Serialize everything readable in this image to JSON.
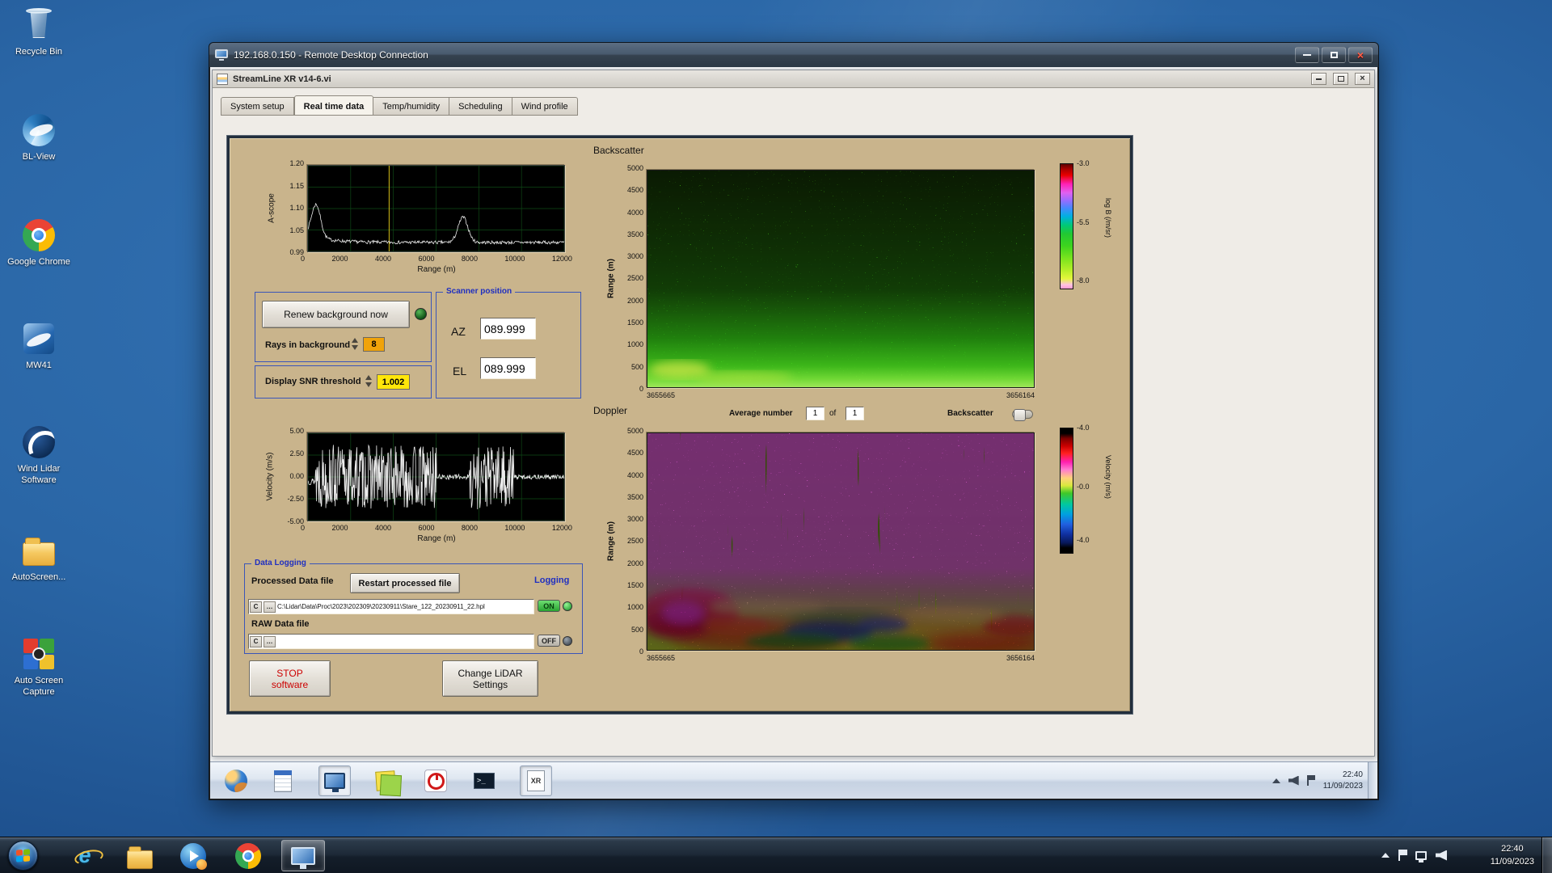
{
  "desktop": {
    "icons": [
      {
        "label": "Recycle Bin"
      },
      {
        "label": "BL-View"
      },
      {
        "label": "Google Chrome"
      },
      {
        "label": "MW41"
      },
      {
        "label": "Wind Lidar Software"
      },
      {
        "label": "AutoScreen..."
      },
      {
        "label": "Auto Screen Capture"
      }
    ]
  },
  "rdp": {
    "title": "192.168.0.150 - Remote Desktop Connection"
  },
  "app": {
    "title": "StreamLine XR v14-6.vi",
    "tabs": [
      {
        "label": "System setup",
        "active": false
      },
      {
        "label": "Real time data",
        "active": true
      },
      {
        "label": "Temp/humidity",
        "active": false
      },
      {
        "label": "Scheduling",
        "active": false
      },
      {
        "label": "Wind profile",
        "active": false
      }
    ]
  },
  "controls": {
    "renew_button": "Renew background now",
    "rays_label": "Rays in background",
    "rays_value": "8",
    "snr_label": "Display SNR threshold",
    "snr_value": "1.002"
  },
  "scanner": {
    "title": "Scanner position",
    "az_label": "AZ",
    "az_value": "089.999",
    "el_label": "EL",
    "el_value": "089.999"
  },
  "logging": {
    "title": "Data Logging",
    "processed_label": "Processed Data file",
    "restart_button": "Restart processed file",
    "drive_letter": "C",
    "processed_path": "C:\\Lidar\\Data\\Proc\\2023\\202309\\20230911\\Stare_122_20230911_22.hpl",
    "raw_label": "RAW Data file",
    "raw_path": "",
    "logging_label": "Logging",
    "on_label": "ON",
    "off_label": "OFF"
  },
  "actions": {
    "stop_line1": "STOP",
    "stop_line2": "software",
    "change_line1": "Change LiDAR",
    "change_line2": "Settings"
  },
  "doppler_controls": {
    "avg_label": "Average number",
    "avg_value": "1",
    "of_label": "of",
    "count_value": "1",
    "toggle_label": "Backscatter"
  },
  "colors": {
    "panel_tan": "#c9b48c",
    "group_border_blue": "#3a55b8",
    "label_blue": "#1f2fc0",
    "rays_value_orange": "#f0a30a",
    "snr_value_yellow": "#ffe60a",
    "on_green": "#2aa432",
    "stop_red": "#cc0000"
  },
  "session_taskbar": {
    "clock_time": "22:40",
    "clock_date": "11/09/2023",
    "cmd_label": ">_",
    "xr_label": "XR",
    "icons": [
      "browser",
      "notepad",
      "remote-desktop",
      "sticky-notes",
      "power",
      "command-prompt",
      "streamline-xr"
    ]
  },
  "taskbar": {
    "clock_time": "22:40",
    "clock_date": "11/09/2023",
    "items": [
      "start",
      "internet-explorer",
      "windows-explorer",
      "windows-media-player",
      "google-chrome",
      "remote-desktop-connection"
    ]
  },
  "chart_data": [
    {
      "id": "ascope",
      "type": "line",
      "kind": "ascope",
      "ylabel": "A-scope",
      "xlabel": "Range (m)",
      "xlim": [
        0,
        12000
      ],
      "ylim": [
        0.99,
        1.2
      ],
      "yticks": [
        "1.20",
        "1.15",
        "1.10",
        "1.05",
        "0.99"
      ],
      "xticks": [
        "0",
        "2000",
        "4000",
        "6000",
        "8000",
        "10000",
        "12000"
      ],
      "cursor_x": 3800,
      "seed": 7,
      "description": "White noisy trace near 1.01 with sharp peak to ~1.10 at range ~370 m decaying by ~2000 m and a secondary bump to ~1.07 near 7260 m; yellow cursor line near 3800 m."
    },
    {
      "id": "velocity",
      "type": "line",
      "kind": "velocity",
      "ylabel": "Velocity (m/s)",
      "xlabel": "Range (m)",
      "xlim": [
        0,
        12000
      ],
      "ylim": [
        -5,
        5
      ],
      "yticks": [
        "5.00",
        "2.50",
        "0.00",
        "-2.50",
        "-5.00"
      ],
      "xticks": [
        "0",
        "2000",
        "4000",
        "6000",
        "8000",
        "10000",
        "12000"
      ],
      "seed": 13,
      "segments": [
        [
          0,
          350,
          -0.5,
          0.4
        ],
        [
          350,
          6050,
          0,
          3.7
        ],
        [
          6050,
          7550,
          0,
          0.3
        ],
        [
          7550,
          9650,
          0,
          3.7
        ],
        [
          9650,
          12001,
          0,
          0.25
        ]
      ],
      "description": "Dense noisy velocity trace spanning ±4 m/s between ~0.35-6 km and ~7.5-9.7 km; near zero elsewhere."
    },
    {
      "id": "backscatter",
      "type": "heatmap",
      "title": "Backscatter",
      "ylabel": "Range (m)",
      "yticks": [
        "5000",
        "4500",
        "4000",
        "3500",
        "3000",
        "2500",
        "2000",
        "1500",
        "1000",
        "500",
        "0"
      ],
      "xticks": [
        "3655665",
        "3656164"
      ],
      "colorbar": {
        "label": "log B (/m/sr)",
        "ticks": [
          "-3.0",
          "-5.5",
          "-8.0"
        ]
      },
      "description": "Speckled green backscatter field over 0-5000 m; brighter green band near the surface below ~400 m with a yellowish patch at lower left."
    },
    {
      "id": "doppler",
      "type": "heatmap",
      "title": "Doppler",
      "ylabel": "Range (m)",
      "yticks": [
        "5000",
        "4500",
        "4000",
        "3500",
        "3000",
        "2500",
        "2000",
        "1500",
        "1000",
        "500",
        "0"
      ],
      "xticks": [
        "3655665",
        "3656164"
      ],
      "colorbar": {
        "label": "Velocity (m/s)",
        "ticks": [
          "-4.0",
          "-0.0",
          "-4.0"
        ]
      },
      "description": "Magenta/pink vertical noise streaks above ~1500 m; turbulent red, green, yellow and dark-blue structures below ~1500 m with a strong red/magenta blob at lower left."
    }
  ]
}
